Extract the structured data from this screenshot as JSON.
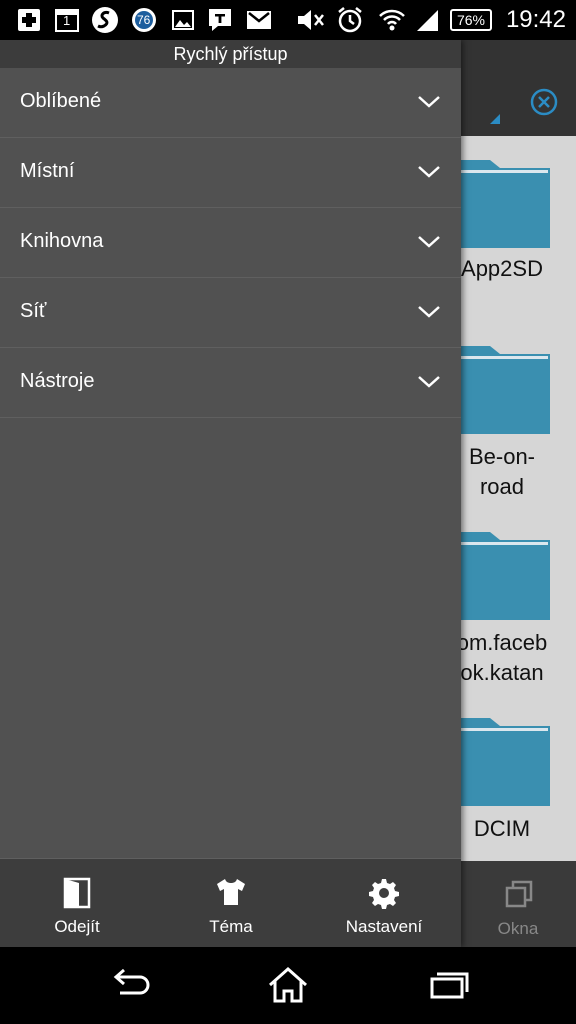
{
  "status_bar": {
    "time": "19:42",
    "battery": "76%",
    "calendar_day": "1",
    "badge_number": "76",
    "icons": [
      "medical-plus-icon",
      "calendar-icon",
      "swype-icon",
      "circle-76-icon",
      "image-icon",
      "text-message-icon",
      "email-icon",
      "muted-speaker-icon",
      "alarm-icon",
      "wifi-icon",
      "signal-icon",
      "battery-icon"
    ]
  },
  "background_app": {
    "folders": [
      "App2SD",
      "Be-on-\nroad",
      "om.faceb\nok.katan",
      "DCIM"
    ],
    "folder_color": "#3a8fb0",
    "bottom_item": "Okna"
  },
  "drawer": {
    "title": "Rychlý přístup",
    "items": [
      {
        "label": "Oblíbené"
      },
      {
        "label": "Místní"
      },
      {
        "label": "Knihovna"
      },
      {
        "label": "Síť"
      },
      {
        "label": "Nástroje"
      }
    ],
    "bottom": {
      "exit": "Odejít",
      "theme": "Téma",
      "settings": "Nastavení"
    }
  },
  "colors": {
    "accent": "#2b8cc4",
    "drawer_bg": "#515151"
  }
}
